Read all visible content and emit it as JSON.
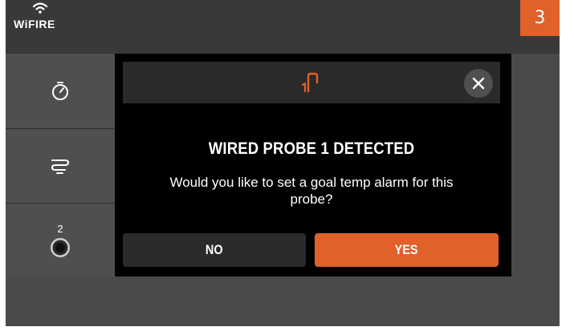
{
  "brand": {
    "name": "WiFIRE",
    "icon": "wifi-icon"
  },
  "step_badge": "3",
  "sidebar": {
    "items": [
      {
        "icon": "timer-icon"
      },
      {
        "icon": "smoke-icon"
      },
      {
        "icon": "probe-jack-icon",
        "count": "2"
      }
    ]
  },
  "modal": {
    "header_icon": "probe-1-icon",
    "title": "WIRED PROBE 1 DETECTED",
    "message": "Would you like to set a goal temp alarm for this probe?",
    "no_label": "NO",
    "yes_label": "YES",
    "close_icon": "close-icon"
  },
  "colors": {
    "accent": "#e0612a",
    "screen_bg": "#4a4a4a",
    "topbar_bg": "#393939",
    "modal_bg": "#000000",
    "modal_panel": "#2a2a2a"
  }
}
